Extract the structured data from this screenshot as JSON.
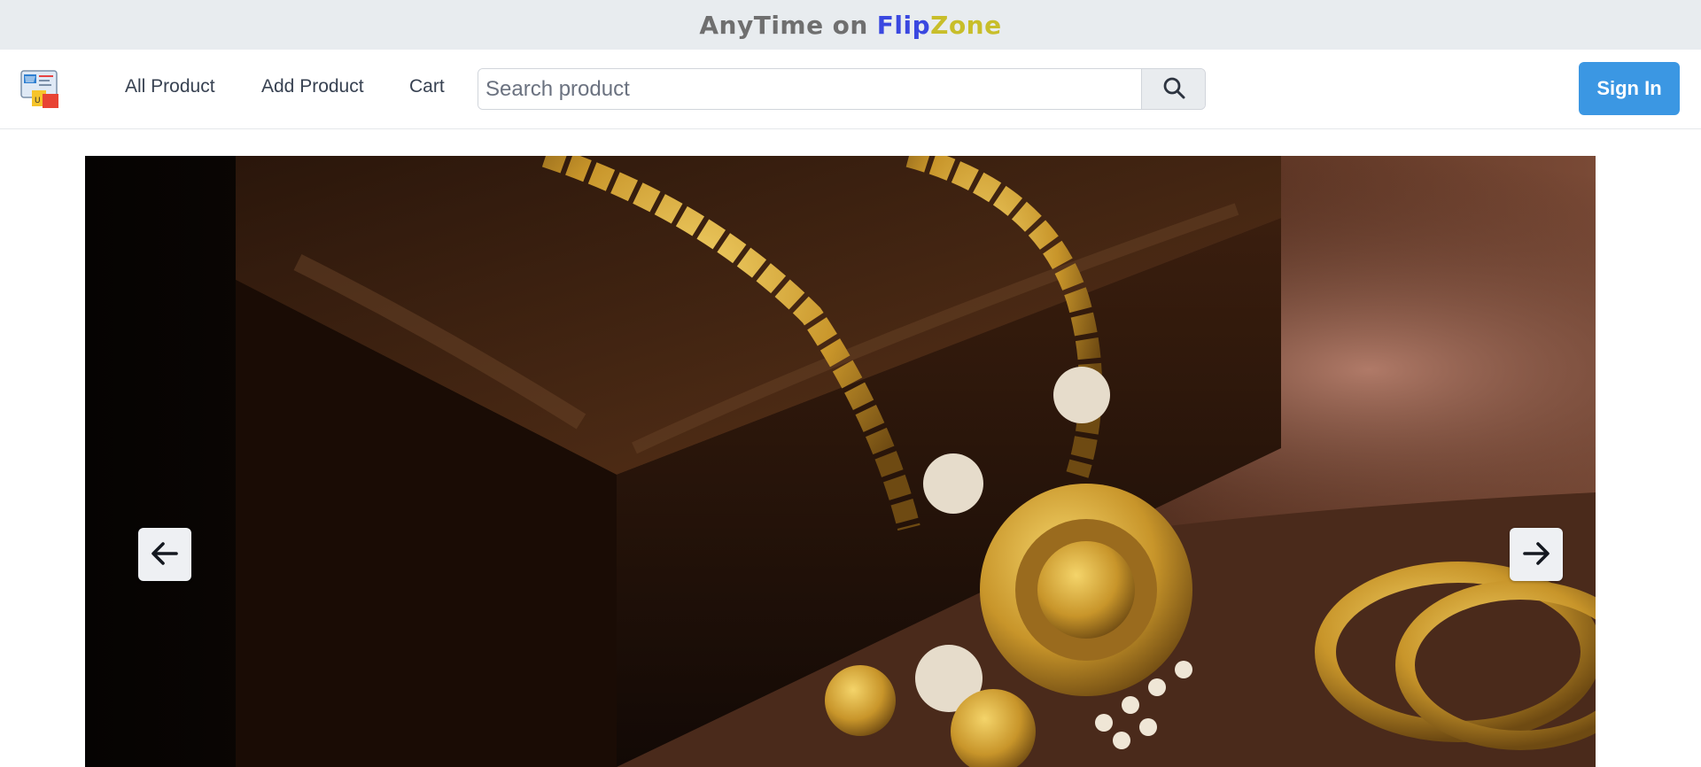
{
  "banner": {
    "part1": "AnyTime",
    "part2": "on",
    "part3": "Flip",
    "part4": "Zone"
  },
  "nav": {
    "logo_icon": "shopping-store-icon",
    "links": [
      {
        "label": "All Product"
      },
      {
        "label": "Add Product"
      },
      {
        "label": "Cart"
      }
    ],
    "search": {
      "placeholder": "Search product",
      "value": "",
      "icon": "search-icon"
    },
    "signin_label": "Sign In"
  },
  "carousel": {
    "prev_icon": "arrow-left-icon",
    "next_icon": "arrow-right-icon",
    "image_alt": "gold-jewelry-banner-image"
  },
  "colors": {
    "banner_bg": "#e8ecef",
    "flip": "#3a48e0",
    "zone": "#c8be2a",
    "signin": "#3b97e3"
  }
}
